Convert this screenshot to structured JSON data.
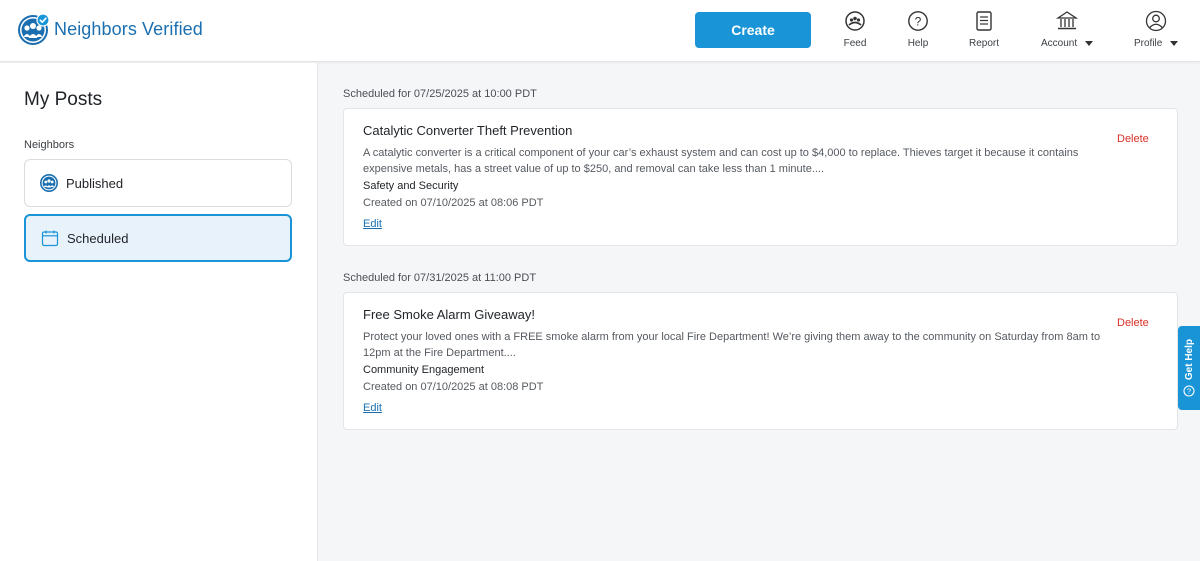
{
  "header": {
    "brand_name": "Neighbors Verified",
    "create_label": "Create",
    "nav": [
      {
        "label": "Feed",
        "icon": "feed-icon"
      },
      {
        "label": "Help",
        "icon": "help-icon"
      },
      {
        "label": "Report",
        "icon": "report-icon"
      },
      {
        "label": "Account",
        "icon": "bank-icon"
      },
      {
        "label": "Profile",
        "icon": "profile-icon"
      }
    ]
  },
  "sidebar": {
    "title": "My Posts",
    "section_label": "Neighbors",
    "items": [
      {
        "label": "Published",
        "icon": "neighbors-icon",
        "active": false
      },
      {
        "label": "Scheduled",
        "icon": "calendar-icon",
        "active": true
      }
    ]
  },
  "posts": [
    {
      "scheduled": "Scheduled for 07/25/2025 at 10:00 PDT",
      "title": "Catalytic Converter Theft Prevention",
      "description": "A catalytic converter is a critical component of your car’s exhaust system and can cost up to $4,000 to replace. Thieves target it because it contains expensive metals, has a street value of up to $250, and removal can take less than 1 minute....",
      "category": "Safety and Security",
      "created": "Created on 07/10/2025 at 08:06 PDT",
      "edit_label": "Edit",
      "delete_label": "Delete"
    },
    {
      "scheduled": "Scheduled for 07/31/2025 at 11:00 PDT",
      "title": "Free Smoke Alarm Giveaway!",
      "description": "Protect your loved ones with a FREE smoke alarm from your local Fire Department! We’re giving them away to the community on Saturday from 8am to 12pm at the Fire Department....",
      "category": "Community Engagement",
      "created": "Created on 07/10/2025 at 08:08 PDT",
      "edit_label": "Edit",
      "delete_label": "Delete"
    }
  ],
  "get_help": {
    "label": "Get Help",
    "icon": "question-circle-icon"
  },
  "colors": {
    "accent": "#1994d6",
    "brand": "#1b6fb0",
    "danger": "#d93025"
  }
}
